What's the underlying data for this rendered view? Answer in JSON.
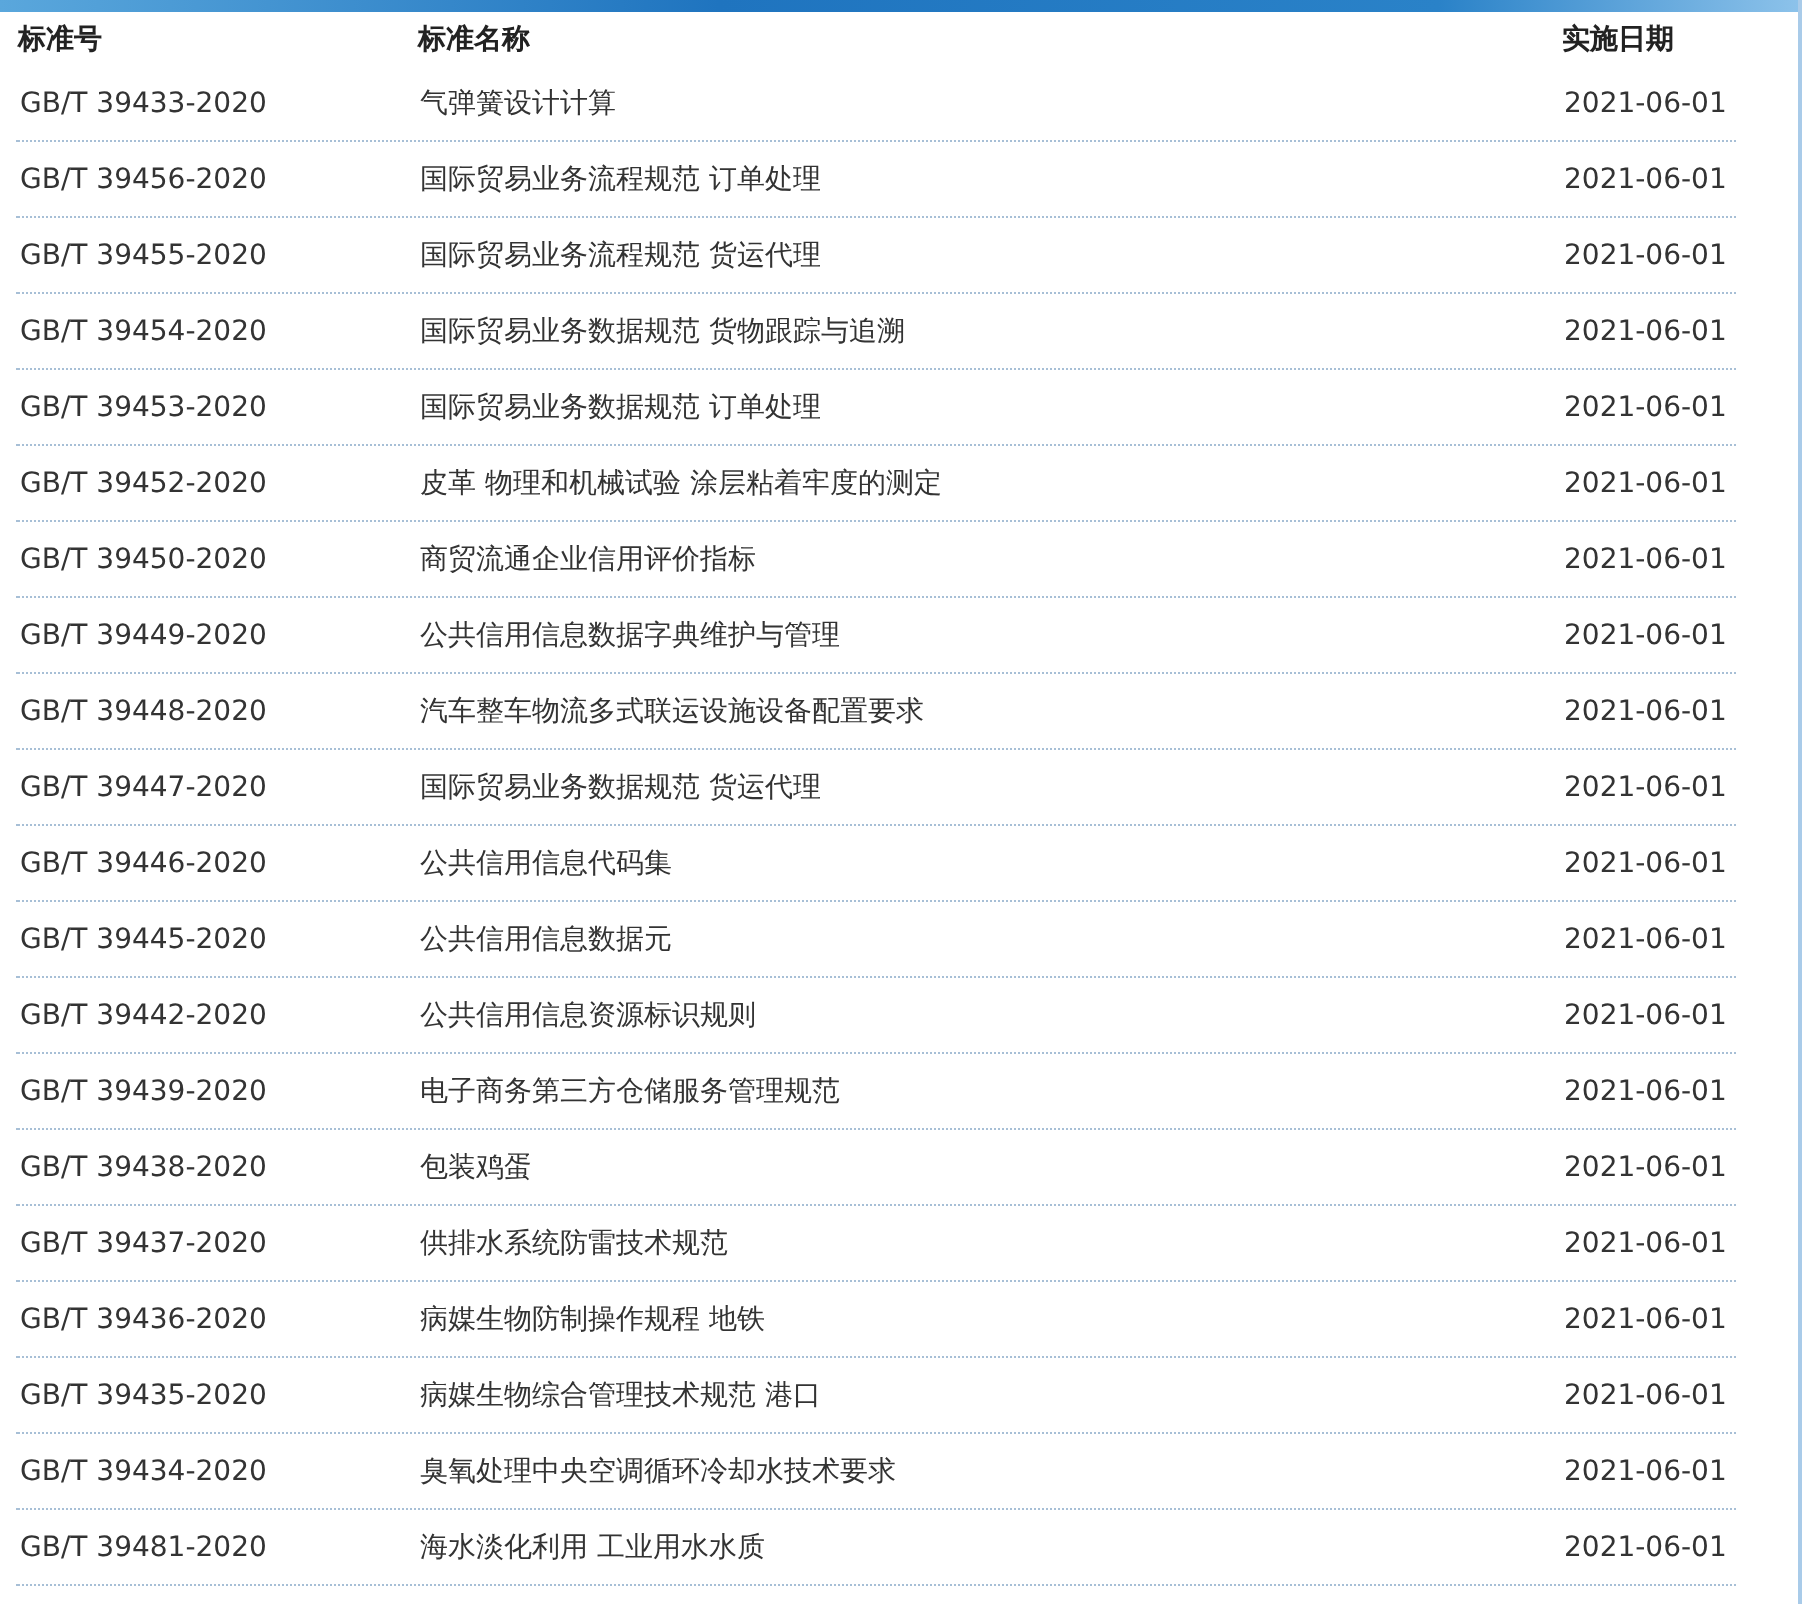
{
  "table": {
    "columns": [
      "标准号",
      "标准名称",
      "实施日期"
    ],
    "rows": [
      [
        "GB/T 39433-2020",
        "气弹簧设计计算",
        "2021-06-01"
      ],
      [
        "GB/T 39456-2020",
        "国际贸易业务流程规范 订单处理",
        "2021-06-01"
      ],
      [
        "GB/T 39455-2020",
        "国际贸易业务流程规范 货运代理",
        "2021-06-01"
      ],
      [
        "GB/T 39454-2020",
        "国际贸易业务数据规范 货物跟踪与追溯",
        "2021-06-01"
      ],
      [
        "GB/T 39453-2020",
        "国际贸易业务数据规范 订单处理",
        "2021-06-01"
      ],
      [
        "GB/T 39452-2020",
        "皮革 物理和机械试验 涂层粘着牢度的测定",
        "2021-06-01"
      ],
      [
        "GB/T 39450-2020",
        "商贸流通企业信用评价指标",
        "2021-06-01"
      ],
      [
        "GB/T 39449-2020",
        "公共信用信息数据字典维护与管理",
        "2021-06-01"
      ],
      [
        "GB/T 39448-2020",
        "汽车整车物流多式联运设施设备配置要求",
        "2021-06-01"
      ],
      [
        "GB/T 39447-2020",
        "国际贸易业务数据规范 货运代理",
        "2021-06-01"
      ],
      [
        "GB/T 39446-2020",
        "公共信用信息代码集",
        "2021-06-01"
      ],
      [
        "GB/T 39445-2020",
        "公共信用信息数据元",
        "2021-06-01"
      ],
      [
        "GB/T 39442-2020",
        "公共信用信息资源标识规则",
        "2021-06-01"
      ],
      [
        "GB/T 39439-2020",
        "电子商务第三方仓储服务管理规范",
        "2021-06-01"
      ],
      [
        "GB/T 39438-2020",
        "包装鸡蛋",
        "2021-06-01"
      ],
      [
        "GB/T 39437-2020",
        "供排水系统防雷技术规范",
        "2021-06-01"
      ],
      [
        "GB/T 39436-2020",
        "病媒生物防制操作规程 地铁",
        "2021-06-01"
      ],
      [
        "GB/T 39435-2020",
        "病媒生物综合管理技术规范 港口",
        "2021-06-01"
      ],
      [
        "GB/T 39434-2020",
        "臭氧处理中央空调循环冷却水技术要求",
        "2021-06-01"
      ],
      [
        "GB/T 39481-2020",
        "海水淡化利用 工业用水水质",
        "2021-06-01"
      ]
    ]
  }
}
